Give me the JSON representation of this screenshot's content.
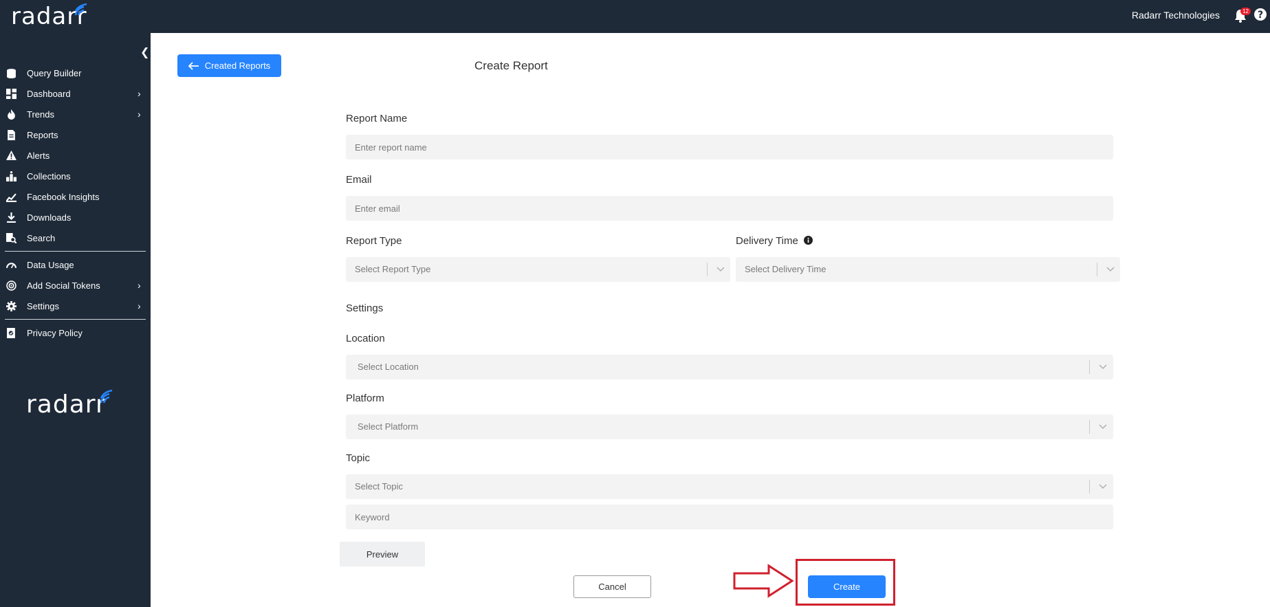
{
  "header": {
    "logo_text": "radarr",
    "company": "Radarr Technologies",
    "notification_count": "12"
  },
  "sidebar": {
    "items": [
      {
        "label": "Query Builder",
        "icon": "database-icon"
      },
      {
        "label": "Dashboard",
        "icon": "dashboard-icon",
        "has_arrow": true
      },
      {
        "label": "Trends",
        "icon": "fire-icon",
        "has_arrow": true
      },
      {
        "label": "Reports",
        "icon": "document-icon"
      },
      {
        "label": "Alerts",
        "icon": "warning-icon"
      },
      {
        "label": "Collections",
        "icon": "collections-icon"
      },
      {
        "label": "Facebook Insights",
        "icon": "chart-line-icon"
      },
      {
        "label": "Downloads",
        "icon": "download-icon"
      },
      {
        "label": "Search",
        "icon": "search-doc-icon"
      },
      {
        "label": "Data Usage",
        "icon": "gauge-icon"
      },
      {
        "label": "Add Social Tokens",
        "icon": "target-icon",
        "has_arrow": true
      },
      {
        "label": "Settings",
        "icon": "gear-icon",
        "has_arrow": true
      },
      {
        "label": "Privacy Policy",
        "icon": "shield-doc-icon"
      }
    ],
    "bottom_logo_text": "radarr"
  },
  "main": {
    "back_button_label": "Created Reports",
    "title": "Create Report",
    "form": {
      "report_name_label": "Report Name",
      "report_name_placeholder": "Enter report name",
      "email_label": "Email",
      "email_placeholder": "Enter email",
      "report_type_label": "Report Type",
      "report_type_placeholder": "Select Report Type",
      "delivery_time_label": "Delivery Time",
      "delivery_time_placeholder": "Select Delivery Time",
      "settings_label": "Settings",
      "location_label": "Location",
      "location_placeholder": "Select Location",
      "platform_label": "Platform",
      "platform_placeholder": "Select Platform",
      "topic_label": "Topic",
      "topic_placeholder": "Select Topic",
      "keyword_placeholder": "Keyword"
    },
    "preview_label": "Preview",
    "cancel_label": "Cancel",
    "create_label": "Create"
  },
  "colors": {
    "sidebar_bg": "#1e2a38",
    "accent": "#2684ff",
    "annotation_red": "#d0202e"
  }
}
